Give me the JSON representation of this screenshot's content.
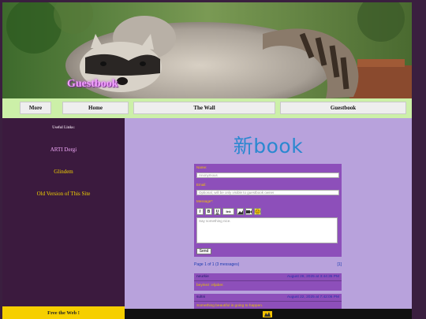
{
  "site": {
    "title": "Guestbook"
  },
  "nav": {
    "items": [
      {
        "label": "More"
      },
      {
        "label": "Home"
      },
      {
        "label": "The Wall"
      },
      {
        "label": "Guestbook"
      }
    ]
  },
  "sidebar": {
    "heading": "Useful Links:",
    "links": [
      {
        "label": "ARTI Dergi"
      },
      {
        "label": "Glindem"
      },
      {
        "label": "Old Version of This Site"
      }
    ],
    "free_web": "Free the Web !"
  },
  "guestbook": {
    "logo": "新book",
    "form": {
      "name_label": "Name:",
      "name_placeholder": "Anonymous",
      "email_label": "Email:",
      "email_placeholder": "Optional, will be only visible to guestbook owner",
      "message_label": "Message*:",
      "format_buttons": [
        "I",
        "B",
        "U",
        "link",
        "img",
        "vid",
        "emoji"
      ],
      "message_placeholder": "Say something nice.",
      "send_label": "Send"
    },
    "pager": {
      "info": "Page 1 of 1 (3 messages)",
      "page": "[1]"
    },
    "entries": [
      {
        "name": "neurkie",
        "date": "August 26, 2025 at 3:44:35 PM",
        "message": "beyinez :eljaber."
      },
      {
        "name": "sultni",
        "date": "August 22, 2025 at 7:42:06 PM",
        "message": "Something beautiful is going to happen."
      }
    ]
  },
  "colors": {
    "navbar_bg": "#ccf0a8",
    "sidebar_bg": "#3b1a3e",
    "main_bg": "#b8a2dc",
    "form_bg": "#8d4fba",
    "logo": "#2a88d0",
    "link": "#f2d200"
  }
}
